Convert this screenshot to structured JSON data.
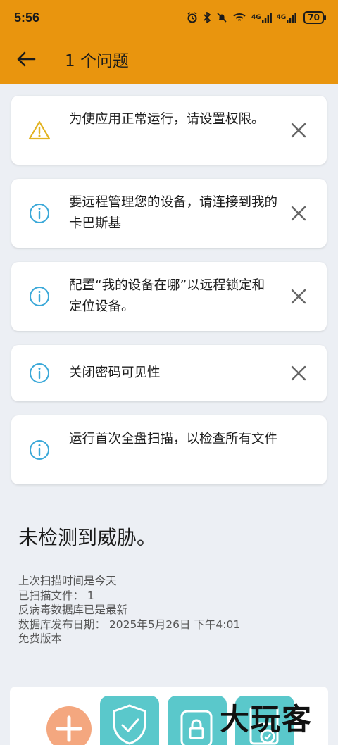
{
  "status_bar": {
    "time": "5:56",
    "network_1": "4G",
    "network_2": "4G",
    "battery": "70"
  },
  "app_bar": {
    "title": "1 个问题"
  },
  "issues": [
    {
      "type": "warning",
      "icon": "warning-triangle-icon",
      "text": "为使应用正常运行，请设置权限。",
      "dismissible": true
    },
    {
      "type": "info",
      "icon": "info-icon",
      "text": "要远程管理您的设备，请连接到我的卡巴斯基",
      "dismissible": true
    },
    {
      "type": "info",
      "icon": "info-icon",
      "text": "配置“我的设备在哪”以远程锁定和定位设备。",
      "dismissible": true
    },
    {
      "type": "info",
      "icon": "info-icon",
      "text": "关闭密码可见性",
      "dismissible": true
    },
    {
      "type": "info",
      "icon": "info-icon",
      "text": "运行首次全盘扫描，以检查所有文件",
      "dismissible": false
    }
  ],
  "summary": {
    "title": "未检测到威胁。",
    "last_scan": "上次扫描时间是今天",
    "files_scanned": "已扫描文件：  1",
    "database_status": "反病毒数据库已是最新",
    "database_date": "数据库发布日期：  2025年5月26日 下午4:01",
    "edition": "免费版本"
  },
  "watermark": "大玩客",
  "colors": {
    "accent": "#e9950e",
    "warning": "#e2b322",
    "info": "#3aa8d8",
    "tile": "#5ac8cb",
    "fab": "#f4a77f"
  }
}
